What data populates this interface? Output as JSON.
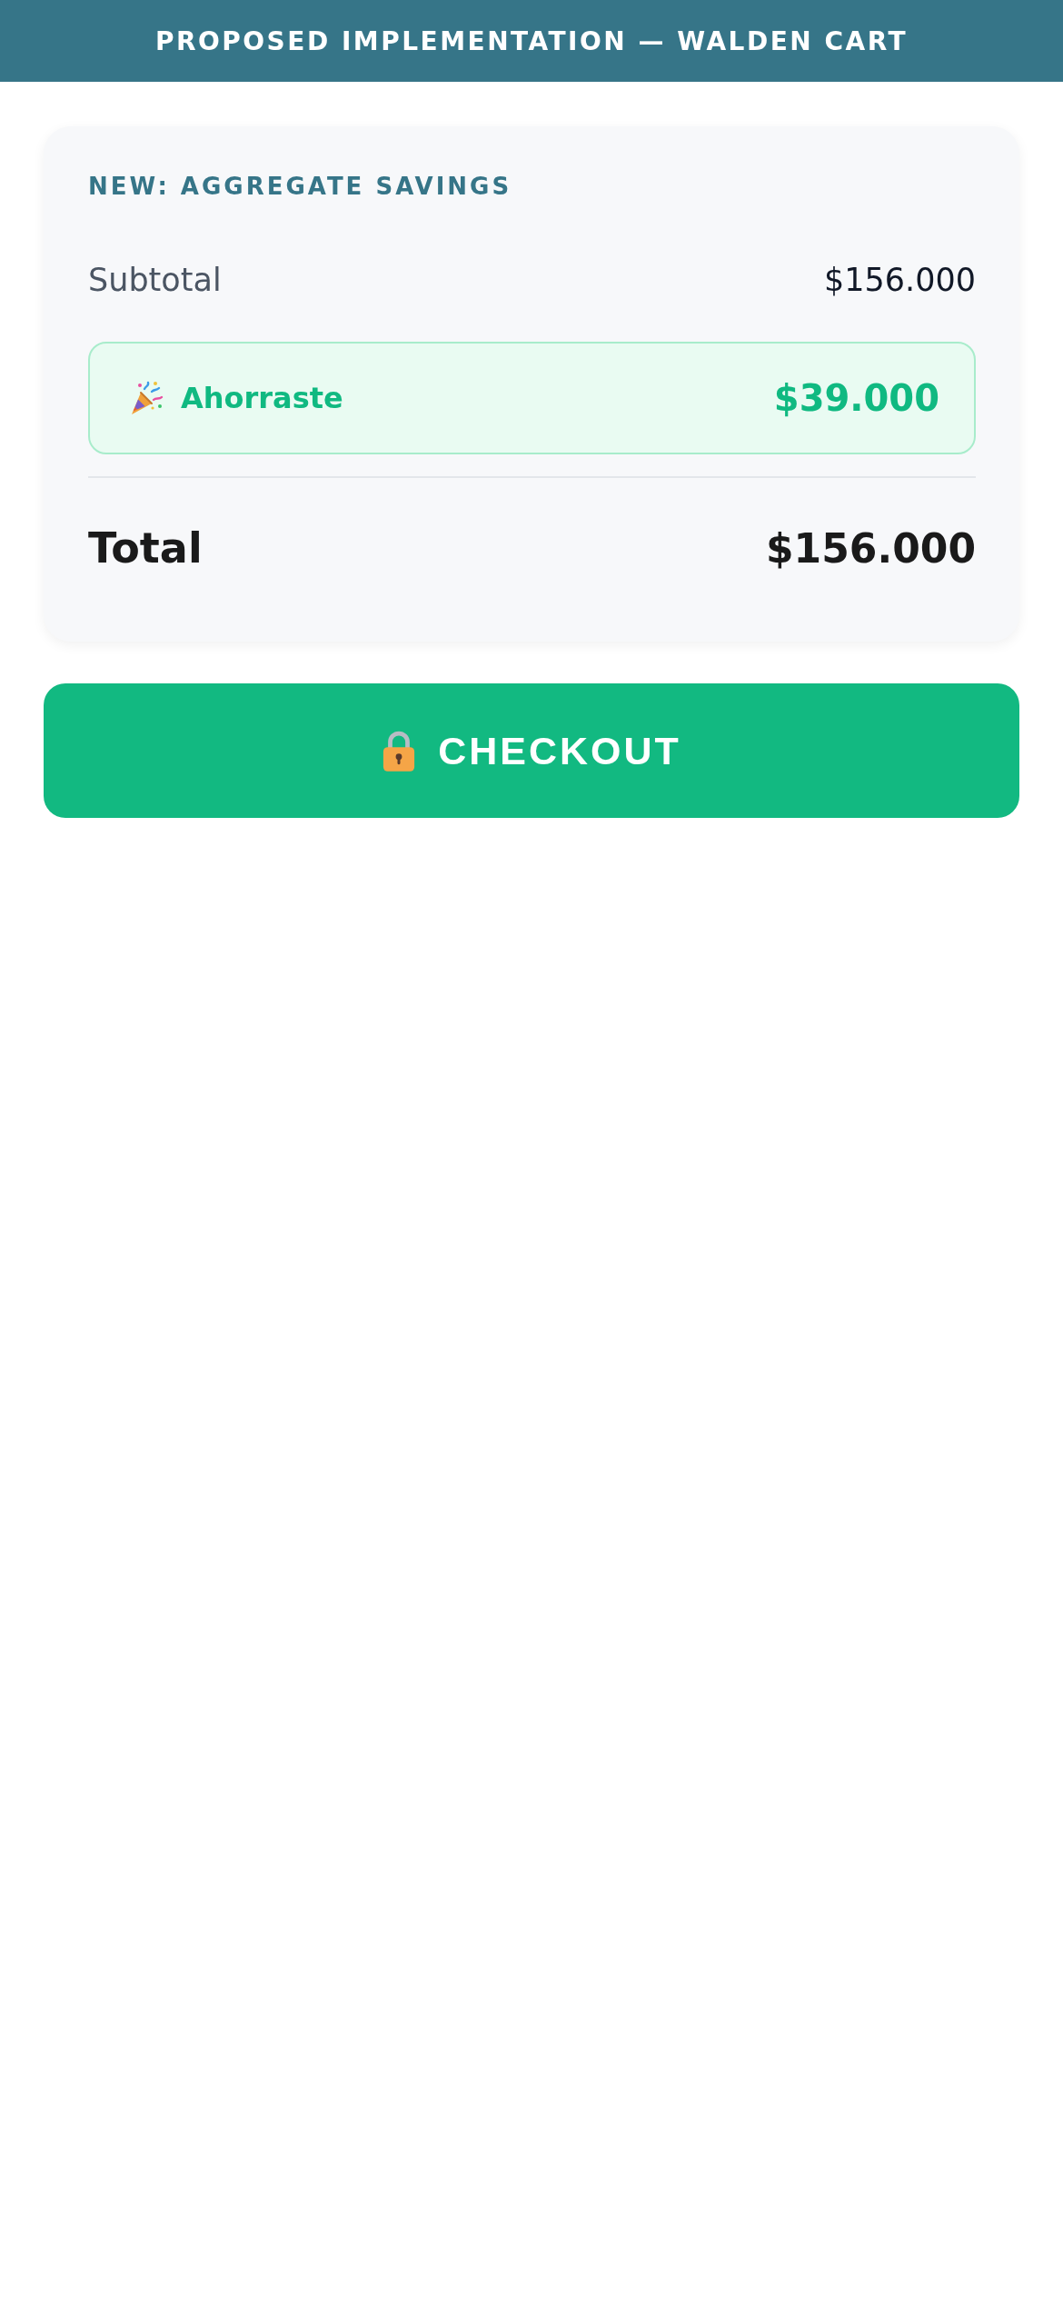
{
  "header": {
    "title": "PROPOSED IMPLEMENTATION — WALDEN CART"
  },
  "summary": {
    "section_label": "NEW: AGGREGATE SAVINGS",
    "subtotal": {
      "label": "Subtotal",
      "value": "$156.000"
    },
    "savings": {
      "label": "Ahorraste",
      "value": "$39.000"
    },
    "total": {
      "label": "Total",
      "value": "$156.000"
    }
  },
  "checkout_button": {
    "label": "CHECKOUT"
  }
}
